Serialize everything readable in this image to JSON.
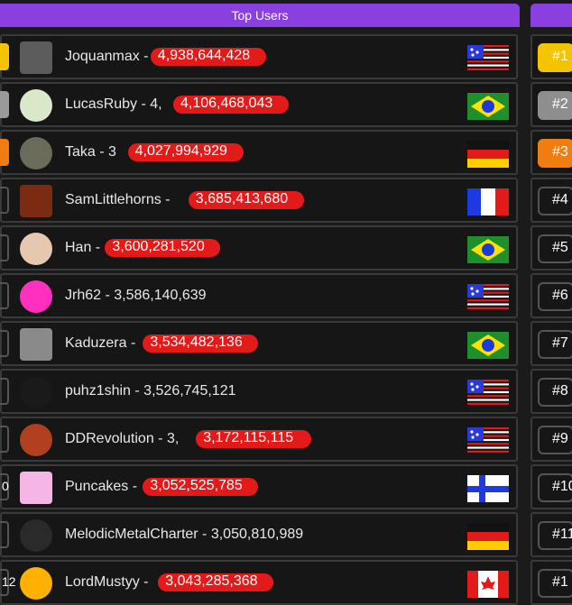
{
  "main_panel": {
    "title": "Top Users",
    "rows": [
      {
        "name": "Joquanmax",
        "score_prefix": "-",
        "score": "4,938,644,428",
        "flag": "usa",
        "scored_hidden": true,
        "stub_class": "gold",
        "stub_label": ""
      },
      {
        "name": "LucasRuby",
        "score_prefix": "- 4,",
        "score": "4,106,468,043",
        "flag": "brazil",
        "scored_hidden": true,
        "stub_class": "silver",
        "stub_label": ""
      },
      {
        "name": "Taka",
        "score_prefix": "- 3",
        "score": "4,027,994,929",
        "flag": "germany",
        "scored_hidden": true,
        "stub_class": "bronze",
        "stub_label": ""
      },
      {
        "name": "SamLittlehorns",
        "score_prefix": "-",
        "score": "3,685,413,680",
        "flag": "france",
        "scored_hidden": true,
        "stub_class": "",
        "stub_label": ""
      },
      {
        "name": "Han",
        "score_prefix": "-",
        "score": "3,600,281,520",
        "flag": "brazil",
        "scored_hidden": true,
        "stub_class": "",
        "stub_label": ""
      },
      {
        "name": "Jrh62",
        "score_prefix": "- 3,586,140,639",
        "score": "",
        "flag": "usa",
        "scored_hidden": false,
        "stub_class": "",
        "stub_label": ""
      },
      {
        "name": "Kaduzera",
        "score_prefix": "-",
        "score": "3,534,482,136",
        "flag": "brazil",
        "scored_hidden": true,
        "stub_class": "",
        "stub_label": ""
      },
      {
        "name": "puhz1shin",
        "score_prefix": "- 3,526,745,121",
        "score": "",
        "flag": "usa",
        "scored_hidden": false,
        "stub_class": "",
        "stub_label": ""
      },
      {
        "name": "DDRevolution",
        "score_prefix": "- 3,",
        "score": "3,172,115,115",
        "flag": "usa",
        "scored_hidden": true,
        "stub_class": "",
        "stub_label": ""
      },
      {
        "name": "Puncakes",
        "score_prefix": "-",
        "score": "3,052,525,785",
        "flag": "finland",
        "scored_hidden": true,
        "stub_class": "",
        "stub_label": "0"
      },
      {
        "name": "MelodicMetalCharter",
        "score_prefix": "- 3,050,810,989",
        "score": "",
        "flag": "germany",
        "scored_hidden": false,
        "stub_class": "",
        "stub_label": ""
      },
      {
        "name": "LordMustyy",
        "score_prefix": "-",
        "score": "3,043,285,368",
        "flag": "canada",
        "scored_hidden": true,
        "stub_class": "",
        "stub_label": "12"
      }
    ]
  },
  "side_panel": {
    "rows": [
      {
        "rank": "#1",
        "badge": "gold"
      },
      {
        "rank": "#2",
        "badge": "silver"
      },
      {
        "rank": "#3",
        "badge": "bronze"
      },
      {
        "rank": "#4",
        "badge": ""
      },
      {
        "rank": "#5",
        "badge": ""
      },
      {
        "rank": "#6",
        "badge": ""
      },
      {
        "rank": "#7",
        "badge": ""
      },
      {
        "rank": "#8",
        "badge": ""
      },
      {
        "rank": "#9",
        "badge": ""
      },
      {
        "rank": "#10",
        "badge": ""
      },
      {
        "rank": "#11",
        "badge": ""
      },
      {
        "rank": "#1",
        "badge": ""
      }
    ]
  },
  "colors": {
    "accent": "#8a3fe0",
    "scribble_red": "#e21a1a",
    "background": "#1b1b1b"
  }
}
